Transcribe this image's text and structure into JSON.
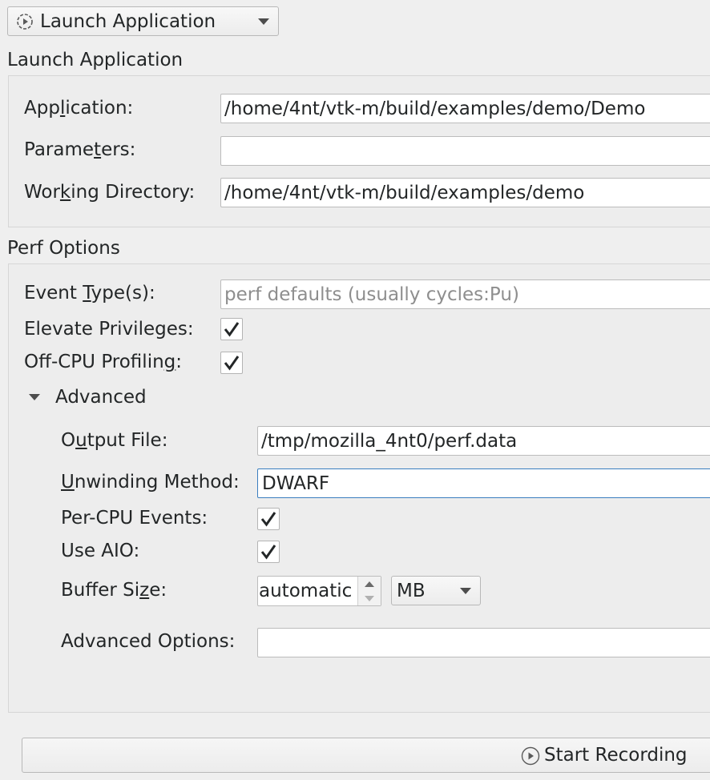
{
  "mode_selector": {
    "icon": "target-icon",
    "selected": "Launch Application"
  },
  "launch_group": {
    "title": "Launch Application",
    "application": {
      "label_pre": "App",
      "label_mnemonic": "l",
      "label_post": "ication:",
      "value": "/home/4nt/vtk-m/build/examples/demo/Demo"
    },
    "parameters": {
      "label_pre": "Parame",
      "label_mnemonic": "t",
      "label_post": "ers:",
      "value": ""
    },
    "working_directory": {
      "label_pre": "Wor",
      "label_mnemonic": "k",
      "label_post": "ing Directory:",
      "value": "/home/4nt/vtk-m/build/examples/demo"
    }
  },
  "perf_group": {
    "title": "Perf Options",
    "event_types": {
      "label_pre": "Event ",
      "label_mnemonic": "T",
      "label_post": "ype(s):",
      "placeholder": "perf defaults (usually cycles:Pu)"
    },
    "elevate_privileges": {
      "label": "Elevate Privileges:",
      "checked": true
    },
    "off_cpu_profiling": {
      "label_pre": "Off-CPU Profilin",
      "label_mnemonic": "g",
      "label_post": ":",
      "checked": true
    },
    "advanced": {
      "title": "Advanced",
      "expanded": true,
      "output_file": {
        "label_pre": "O",
        "label_mnemonic": "u",
        "label_post": "tput File:",
        "value": "/tmp/mozilla_4nt0/perf.data"
      },
      "unwinding_method": {
        "label_pre": "",
        "label_mnemonic": "U",
        "label_post": "nwinding Method:",
        "value": "DWARF"
      },
      "per_cpu_events": {
        "label": "Per-CPU Events:",
        "checked": true
      },
      "use_aio": {
        "label": "Use AIO:",
        "checked": true
      },
      "buffer_size": {
        "label_pre": "Buffer Si",
        "label_mnemonic": "z",
        "label_post": "e:",
        "value": "automatic",
        "unit": "MB"
      },
      "advanced_options": {
        "label": "Advanced Options:",
        "value": ""
      }
    }
  },
  "start_button": {
    "icon": "play-icon",
    "label": "Start Recording"
  },
  "colors": {
    "window_bg": "#efefef",
    "focus_border": "#3a7ebf",
    "check": "#232627"
  }
}
